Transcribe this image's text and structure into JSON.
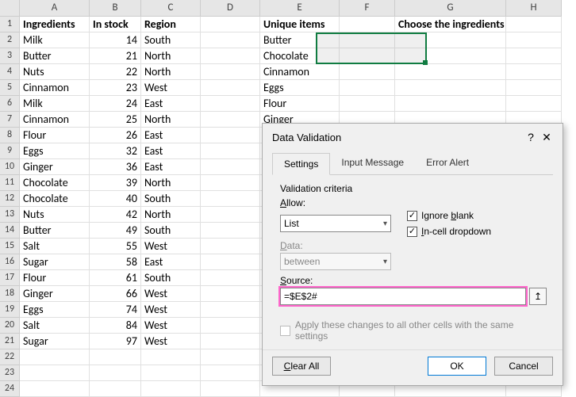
{
  "columns": [
    "A",
    "B",
    "C",
    "D",
    "E",
    "F",
    "G",
    "H"
  ],
  "headers": {
    "A1": "Ingredients",
    "B1": "In stock",
    "C1": "Region",
    "E1": "Unique items",
    "G1": "Choose the ingredients"
  },
  "table": [
    {
      "a": "Milk",
      "b": 14,
      "c": "South"
    },
    {
      "a": "Butter",
      "b": 21,
      "c": "North"
    },
    {
      "a": "Nuts",
      "b": 22,
      "c": "North"
    },
    {
      "a": "Cinnamon",
      "b": 23,
      "c": "West"
    },
    {
      "a": "Milk",
      "b": 24,
      "c": "East"
    },
    {
      "a": "Cinnamon",
      "b": 25,
      "c": "North"
    },
    {
      "a": "Flour",
      "b": 26,
      "c": "East"
    },
    {
      "a": "Eggs",
      "b": 32,
      "c": "East"
    },
    {
      "a": "Ginger",
      "b": 36,
      "c": "East"
    },
    {
      "a": "Chocolate",
      "b": 39,
      "c": "North"
    },
    {
      "a": "Chocolate",
      "b": 40,
      "c": "South"
    },
    {
      "a": "Nuts",
      "b": 42,
      "c": "North"
    },
    {
      "a": "Butter",
      "b": 49,
      "c": "South"
    },
    {
      "a": "Salt",
      "b": 55,
      "c": "West"
    },
    {
      "a": "Sugar",
      "b": 58,
      "c": "East"
    },
    {
      "a": "Flour",
      "b": 61,
      "c": "South"
    },
    {
      "a": "Ginger",
      "b": 66,
      "c": "West"
    },
    {
      "a": "Eggs",
      "b": 74,
      "c": "West"
    },
    {
      "a": "Salt",
      "b": 84,
      "c": "West"
    },
    {
      "a": "Sugar",
      "b": 97,
      "c": "West"
    }
  ],
  "unique": [
    "Butter",
    "Chocolate",
    "Cinnamon",
    "Eggs",
    "Flour",
    "Ginger"
  ],
  "rows_total": 24,
  "dialog": {
    "title": "Data Validation",
    "help": "?",
    "close": "✕",
    "tabs": {
      "settings": "Settings",
      "input": "Input Message",
      "error": "Error Alert"
    },
    "criteria_label": "Validation criteria",
    "allow_label": "Allow:",
    "allow_value": "List",
    "data_label": "Data:",
    "data_value": "between",
    "ignore_blank": "Ignore blank",
    "incell": "In-cell dropdown",
    "source_label": "Source:",
    "source_value": "=$E$2#",
    "apply": "Apply these changes to all other cells with the same settings",
    "clear": "Clear All",
    "ok": "OK",
    "cancel": "Cancel"
  }
}
